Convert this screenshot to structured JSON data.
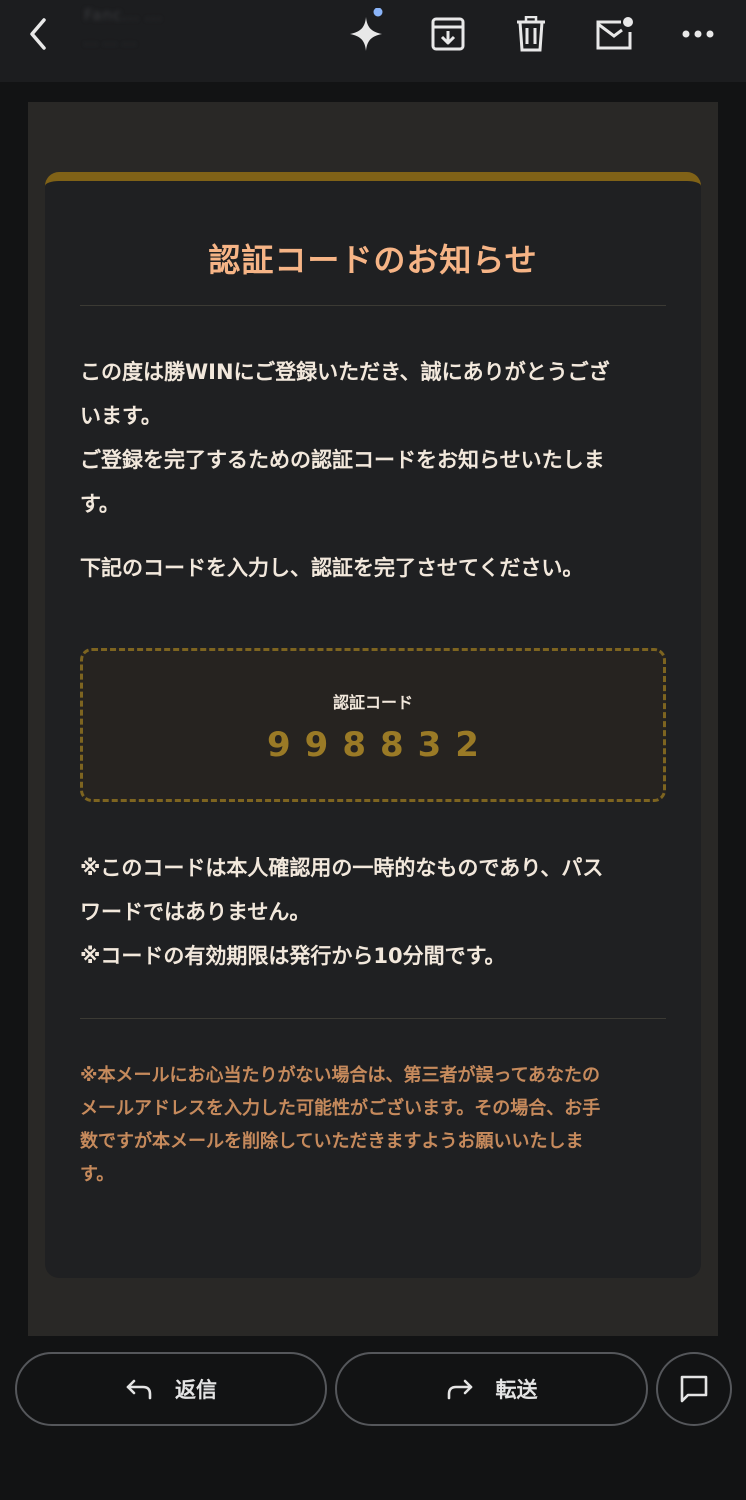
{
  "toolbar": {
    "back_icon": "chevron-left-icon",
    "sender_name": "Fanc... ...",
    "sender_sub": "... ... ...",
    "gemini_icon": "sparkle-icon",
    "archive_icon": "archive-icon",
    "delete_icon": "trash-icon",
    "mark_unread_icon": "mail-unread-icon",
    "more_icon": "more-horizontal-icon",
    "accent_dot_color": "#8ab4f8"
  },
  "email": {
    "title": "認証コードのお知らせ",
    "intro_lines": [
      "この度は勝WINにご登録いただき、誠にありがとうござ",
      "います。",
      "ご登録を完了するための認証コードをお知らせいたしま",
      "す。"
    ],
    "instruction": "下記のコードを入力し、認証を完了させてください。",
    "code_label": "認証コード",
    "code_value": "998832",
    "notes_lines": [
      "※このコードは本人確認用の一時的なものであり、パス",
      "ワードではありません。",
      "※コードの有効期限は発行から10分間です。"
    ],
    "footer_lines": [
      "※本メールにお心当たりがない場合は、第三者が誤ってあなたの",
      "メールアドレスを入力した可能性がございます。その場合、お手",
      "数ですが本メールを削除していただきますようお願いいたしま",
      "す。"
    ],
    "colors": {
      "title": "#f6b486",
      "accent_bar": "#806217",
      "code": "#9a7a26",
      "footer": "#c68a5c"
    }
  },
  "actions": {
    "reply_label": "返信",
    "reply_icon": "reply-arrow-icon",
    "forward_label": "転送",
    "forward_icon": "forward-arrow-icon",
    "chat_icon": "chat-bubble-icon"
  }
}
